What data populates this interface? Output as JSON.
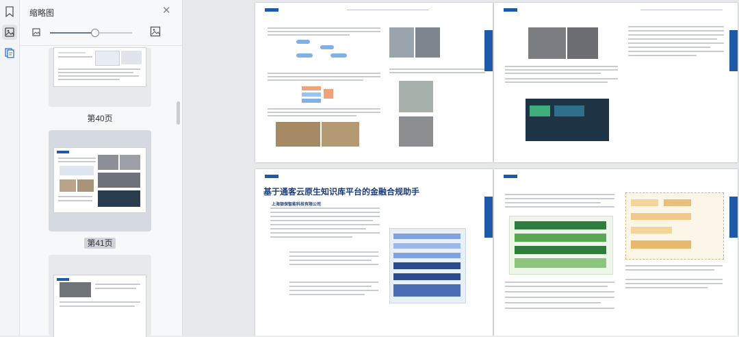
{
  "sidebar": {
    "title": "缩略图",
    "zoom_level": 0.55,
    "thumbnails": [
      {
        "label": "第40页",
        "selected": false
      },
      {
        "label": "第41页",
        "selected": true
      },
      {
        "label": "",
        "selected": false
      }
    ]
  },
  "icons": {
    "bookmark": "bookmark-icon",
    "thumbnail": "thumbnail-view-icon",
    "annotation": "annotation-icon",
    "close": "close-icon",
    "zoom_small": "image-small-icon",
    "zoom_large": "image-large-icon"
  },
  "document": {
    "heading_text": "基于通客云原生知识库平台的金融合规助手",
    "subheading": "上海银保智能科技有限公司",
    "accent_color": "#1f5aa8"
  }
}
